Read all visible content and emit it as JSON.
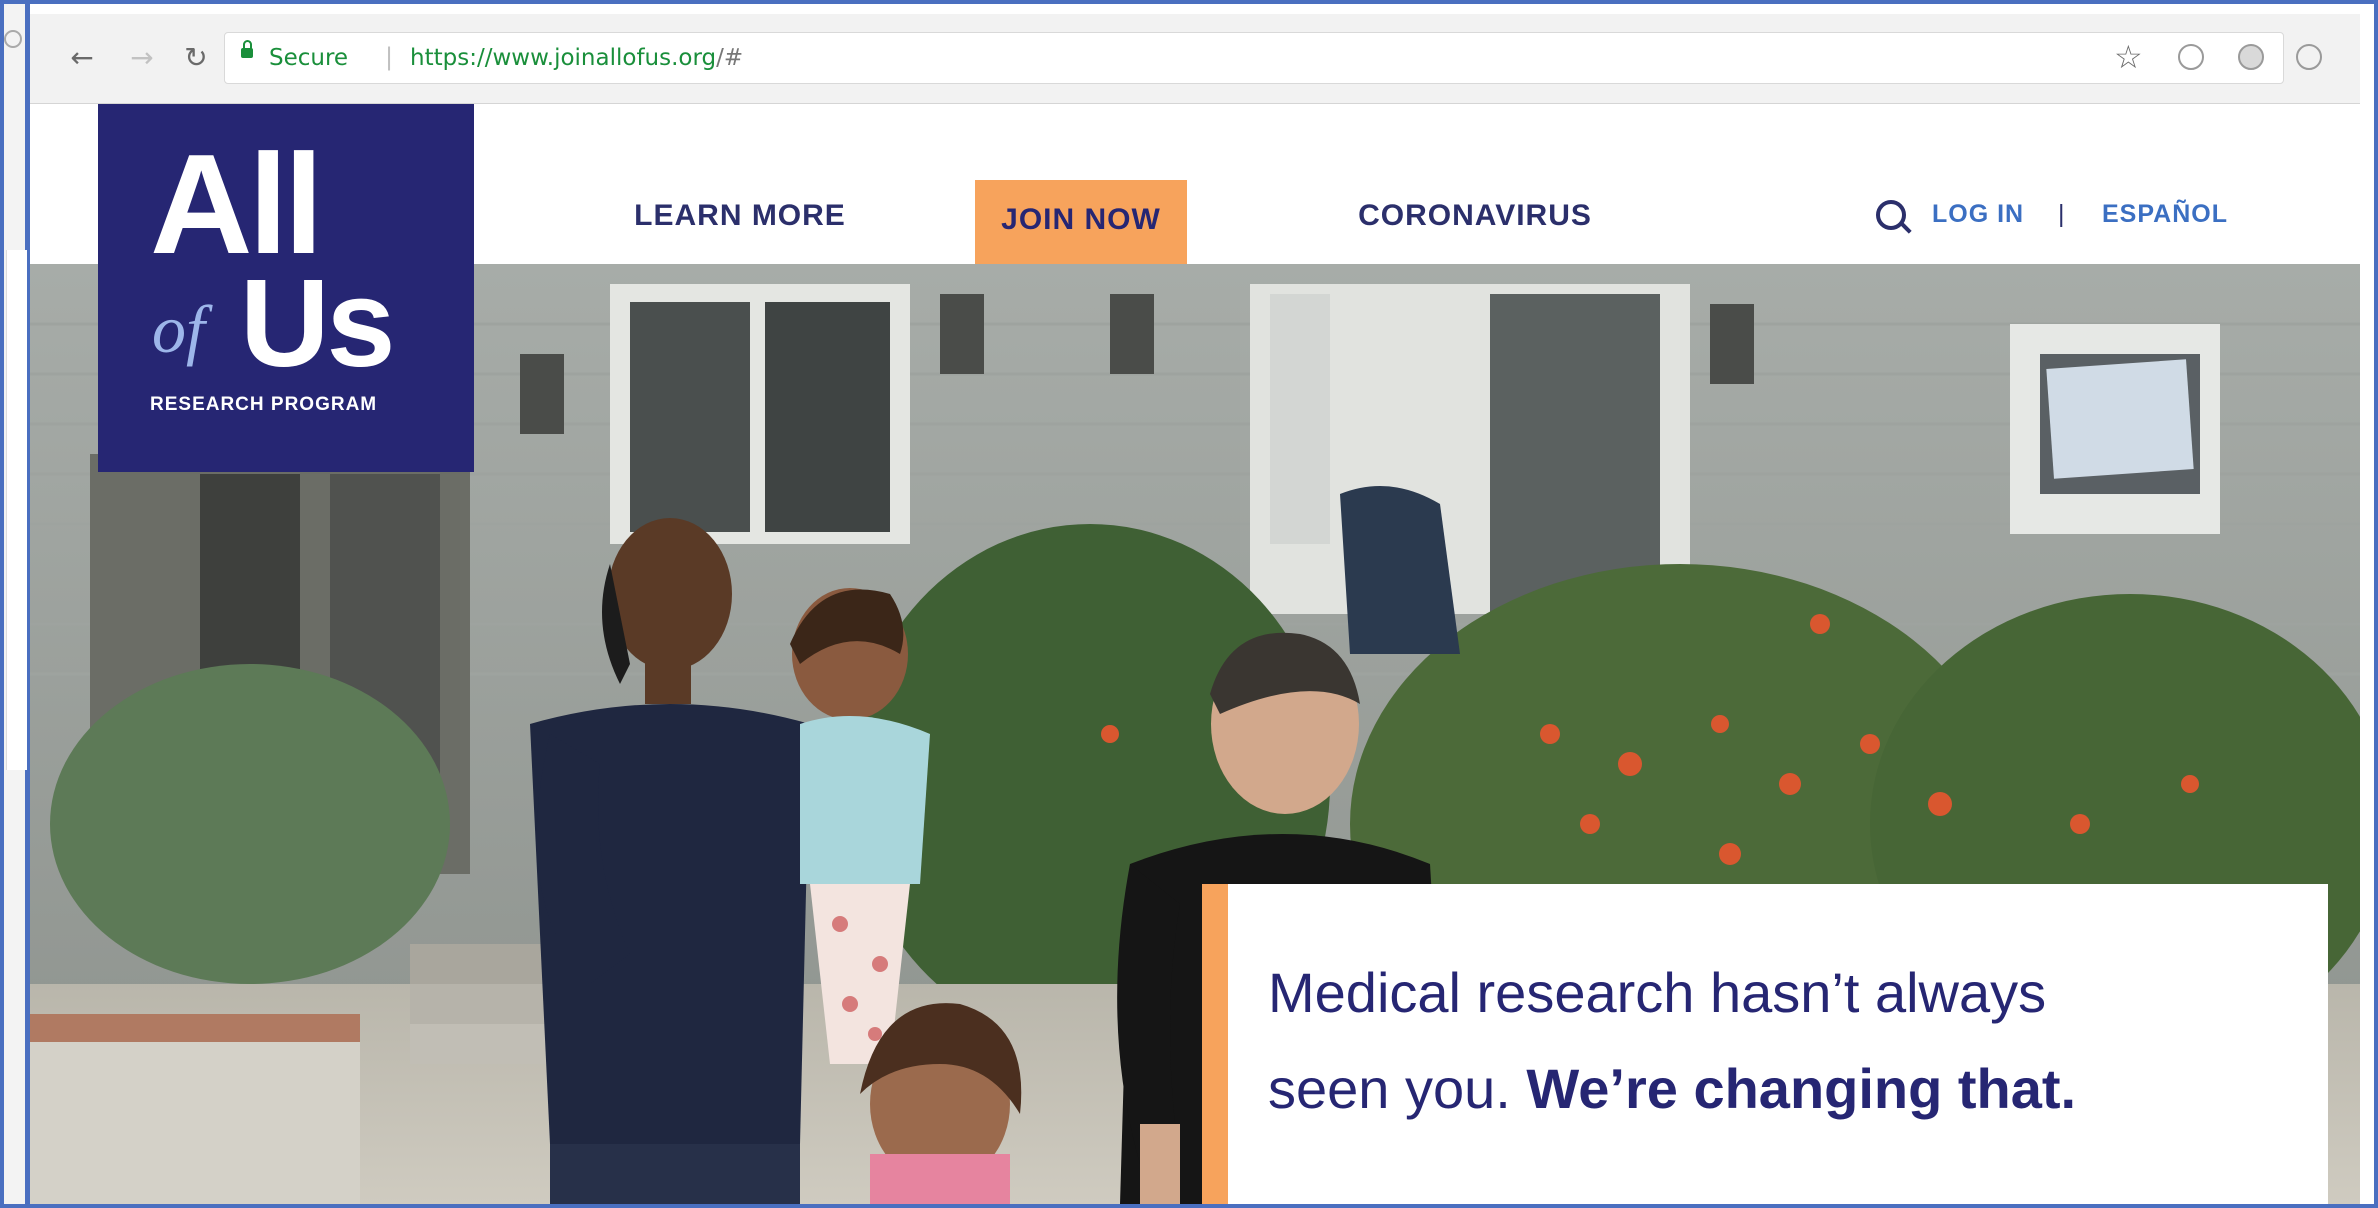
{
  "browser": {
    "secure_label": "Secure",
    "url_host": "https://www.joinallofus.org",
    "url_path": "/#"
  },
  "logo": {
    "all": "All",
    "of": "of",
    "us": "Us",
    "subtitle": "RESEARCH PROGRAM"
  },
  "nav": {
    "learn_more": "LEARN MORE",
    "join_now": "JOIN NOW",
    "coronavirus": "CORONAVIRUS"
  },
  "utility": {
    "login": "LOG IN",
    "separator": "|",
    "espanol": "ESPAÑOL"
  },
  "hero": {
    "line1": "Medical research hasn’t always",
    "line2_regular": "seen you.",
    "line2_bold": "We’re changing that."
  },
  "colors": {
    "brand_navy": "#262673",
    "accent_orange": "#f7a35c",
    "link_blue": "#3b6fc2",
    "secure_green": "#1a8f3b"
  },
  "icons": [
    "back-arrow-icon",
    "forward-arrow-icon",
    "reload-icon",
    "lock-icon",
    "star-icon",
    "extension-icon",
    "search-icon"
  ]
}
